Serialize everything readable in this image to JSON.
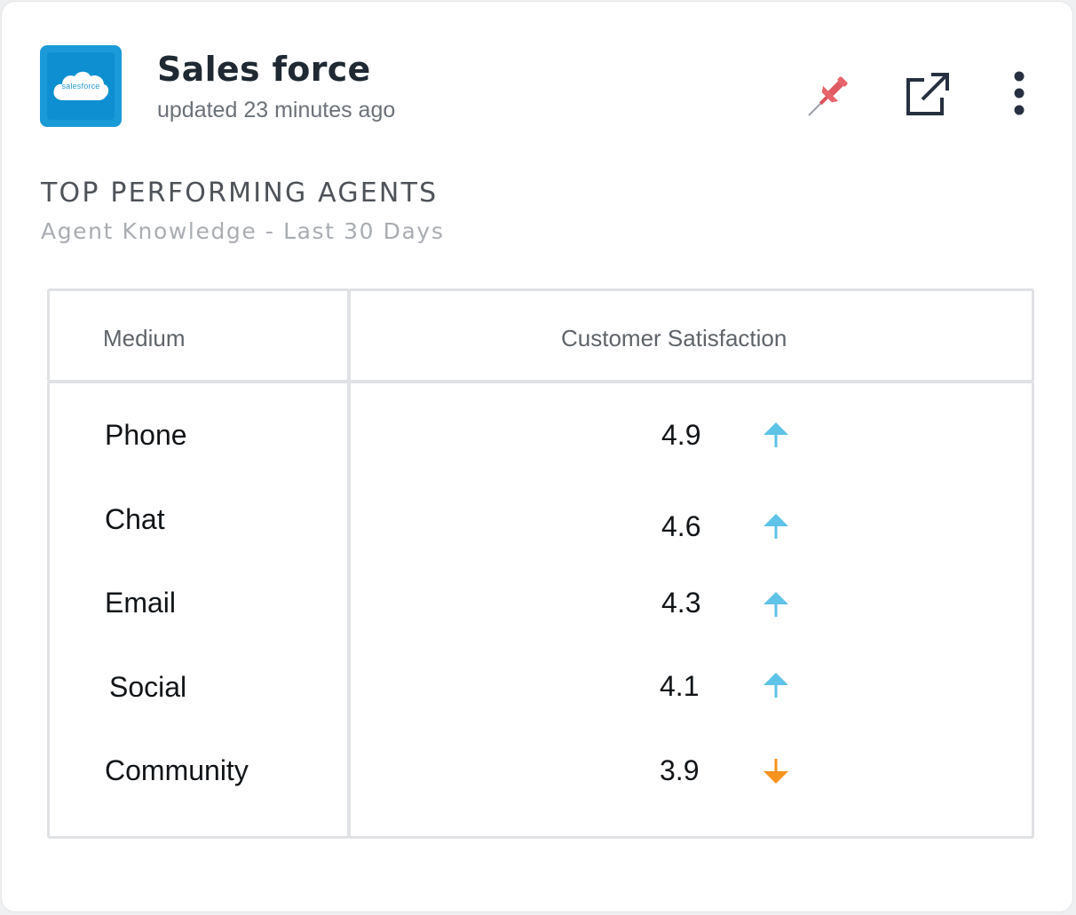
{
  "header": {
    "logo_text": "salesforce",
    "title": "Sales force",
    "updated": "updated 23 minutes ago",
    "icons": [
      "pin-icon",
      "external-link-icon",
      "more-vertical-icon"
    ]
  },
  "section": {
    "title": "TOP PERFORMING AGENTS",
    "subtitle": "Agent Knowledge - Last 30 Days"
  },
  "table": {
    "columns": [
      "Medium",
      "Customer Satisfaction"
    ],
    "rows": [
      {
        "medium": "Phone",
        "score": "4.9",
        "trend": "up"
      },
      {
        "medium": "Chat",
        "score": "4.6",
        "trend": "up"
      },
      {
        "medium": "Email",
        "score": "4.3",
        "trend": "up"
      },
      {
        "medium": "Social",
        "score": "4.1",
        "trend": "up"
      },
      {
        "medium": "Community",
        "score": "3.9",
        "trend": "down"
      }
    ]
  },
  "colors": {
    "brand_blue": "#1b9ad8",
    "trend_up": "#5ec3e6",
    "trend_down": "#f7931e",
    "pin": "#e8636b"
  }
}
